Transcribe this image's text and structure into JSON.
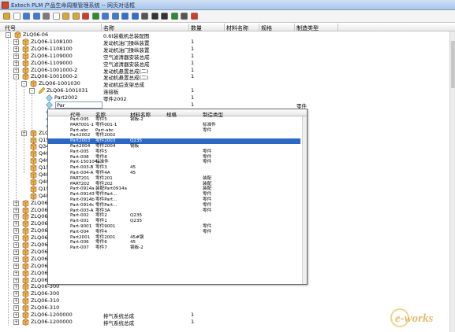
{
  "window": {
    "title": "Extech PLM 产品生命周期管理系统 -- 网页对话框"
  },
  "toolbar": {
    "icons": [
      "folder-icon",
      "new-icon",
      "move-icon",
      "add-icon",
      "cut-icon",
      "copy-icon",
      "paste-icon",
      "paste-special-icon",
      "delete-icon",
      "check-icon",
      "save-icon",
      "undo-icon",
      "up-icon",
      "down-icon",
      "tree-icon",
      "binoculars-icon",
      "sort-icon",
      "export-icon",
      "print-icon",
      "close-icon"
    ]
  },
  "columns": {
    "code": "代号",
    "name": "名称",
    "qty": "数量",
    "material": "材料名称",
    "spec": "规格",
    "mfg_type": "制造类型"
  },
  "rows": [
    {
      "code": "ZLQ06-06",
      "name": "0.6t装载机总装配图",
      "qty": "",
      "mfg": ""
    },
    {
      "code": "ZLQ06-1108100",
      "name": "发动机油门操纵装置",
      "qty": "1",
      "mfg": ""
    },
    {
      "code": "ZLQ06-1108100",
      "name": "发动机油门操纵装置",
      "qty": "1",
      "mfg": ""
    },
    {
      "code": "ZLQ06-1109000",
      "name": "空气滤清器安装总成",
      "qty": "1",
      "mfg": ""
    },
    {
      "code": "ZLQ06-1109000",
      "name": "空气滤清器安装总成",
      "qty": "1",
      "mfg": ""
    },
    {
      "code": "ZLQ06-1001000-2",
      "name": "发动机悬置总成(二)",
      "qty": "1",
      "mfg": ""
    },
    {
      "code": "ZLQ06-1001000-2",
      "name": "发动机悬置总成(二)",
      "qty": "1",
      "mfg": ""
    },
    {
      "code": "ZLQ06-1001030",
      "name": "发动机后支架总成",
      "qty": "",
      "mfg": ""
    },
    {
      "code": "ZLQ06-1001031",
      "name": "连接板",
      "qty": "1",
      "mfg": ""
    },
    {
      "code": "Part2002",
      "name": "零件2002",
      "qty": "1",
      "mfg": ""
    },
    {
      "code": "Par",
      "name": "",
      "qty": "1",
      "mfg": "零件"
    },
    {
      "code": "",
      "name": "",
      "qty": "",
      "mfg": ""
    },
    {
      "code": "ZLQ",
      "name": "",
      "qty": "",
      "mfg": ""
    },
    {
      "code": "ZLQ",
      "name": "",
      "qty": "",
      "mfg": ""
    },
    {
      "code": "ZLQ06-",
      "name": "",
      "qty": "",
      "mfg": ""
    },
    {
      "code": "Q1508",
      "name": "",
      "qty": "",
      "mfg": ""
    },
    {
      "code": "Q3408",
      "name": "",
      "qty": "",
      "mfg": ""
    },
    {
      "code": "Q40310",
      "name": "",
      "qty": "",
      "mfg": ""
    },
    {
      "code": "Q40110",
      "name": "",
      "qty": "",
      "mfg": ""
    },
    {
      "code": "Q1508",
      "name": "",
      "qty": "",
      "mfg": ""
    },
    {
      "code": "Q40220",
      "name": "",
      "qty": "",
      "mfg": ""
    },
    {
      "code": "Q40310",
      "name": "",
      "qty": "",
      "mfg": ""
    },
    {
      "code": "Q1508",
      "name": "",
      "qty": "",
      "mfg": ""
    },
    {
      "code": "Q40310",
      "name": "",
      "qty": "",
      "mfg": ""
    },
    {
      "code": "ZLQ06-860",
      "name": "",
      "qty": "",
      "mfg": ""
    },
    {
      "code": "ZLQ06-860",
      "name": "",
      "qty": "",
      "mfg": ""
    },
    {
      "code": "ZLQ06-860",
      "name": "",
      "qty": "",
      "mfg": ""
    },
    {
      "code": "ZLQ06-120",
      "name": "",
      "qty": "",
      "mfg": ""
    },
    {
      "code": "ZLQ06-120",
      "name": "",
      "qty": "",
      "mfg": ""
    },
    {
      "code": "ZLQ06-280",
      "name": "",
      "qty": "",
      "mfg": ""
    },
    {
      "code": "ZLQ06-280",
      "name": "",
      "qty": "",
      "mfg": ""
    },
    {
      "code": "ZLQ06-680",
      "name": "",
      "qty": "",
      "mfg": ""
    },
    {
      "code": "ZLQ06-680",
      "name": "",
      "qty": "",
      "mfg": ""
    },
    {
      "code": "ZLQ06-370",
      "name": "",
      "qty": "",
      "mfg": ""
    },
    {
      "code": "ZLQ06-820",
      "name": "",
      "qty": "",
      "mfg": ""
    },
    {
      "code": "ZLQ06-820",
      "name": "",
      "qty": "",
      "mfg": ""
    },
    {
      "code": "ZLQ06-300",
      "name": "",
      "qty": "",
      "mfg": ""
    },
    {
      "code": "ZLQ06-300",
      "name": "",
      "qty": "",
      "mfg": ""
    },
    {
      "code": "ZLQ06-310",
      "name": "",
      "qty": "",
      "mfg": ""
    },
    {
      "code": "ZLQ06-310",
      "name": "",
      "qty": "",
      "mfg": ""
    },
    {
      "code": "ZLQ06-1200000",
      "name": "排气系统总成",
      "qty": "1",
      "mfg": ""
    },
    {
      "code": "ZLQ06-1200000",
      "name": "排气系统总成",
      "qty": "1",
      "mfg": ""
    }
  ],
  "popup": {
    "columns": {
      "code": "代号",
      "name": "名称",
      "material": "材料名称",
      "spec": "规格",
      "mfg": "制造类型"
    },
    "rows": [
      {
        "code": "Part-005",
        "name": "零件5",
        "material": "钢板-2",
        "spec": "",
        "mfg": ""
      },
      {
        "code": "PART001-1",
        "name": "零件001-1",
        "material": "",
        "spec": "",
        "mfg": "标准件"
      },
      {
        "code": "Part-abc",
        "name": "Part-abc",
        "material": "",
        "spec": "",
        "mfg": "零件"
      },
      {
        "code": "Part2002",
        "name": "零件2002",
        "material": "",
        "spec": "",
        "mfg": ""
      },
      {
        "code": "Part2003",
        "name": "零件2003",
        "material": "Q235",
        "spec": "",
        "mfg": ""
      },
      {
        "code": "Part2004",
        "name": "零件2004",
        "material": "钢板",
        "spec": "",
        "mfg": ""
      },
      {
        "code": "Part-005",
        "name": "零件5",
        "material": "",
        "spec": "",
        "mfg": "零件"
      },
      {
        "code": "Part-008",
        "name": "零件8",
        "material": "",
        "spec": "",
        "mfg": "零件"
      },
      {
        "code": "Part-150104a",
        "name": "标准件",
        "material": "",
        "spec": "",
        "mfg": "零件"
      },
      {
        "code": "Part-003-B",
        "name": "零件3",
        "material": "45",
        "spec": "",
        "mfg": ""
      },
      {
        "code": "Part-004-A",
        "name": "零件4A",
        "material": "45",
        "spec": "",
        "mfg": ""
      },
      {
        "code": "PART201",
        "name": "零件201",
        "material": "",
        "spec": "",
        "mfg": "装配"
      },
      {
        "code": "PART202",
        "name": "零件202",
        "material": "",
        "spec": "",
        "mfg": "装配"
      },
      {
        "code": "Part-0914a",
        "name": "装配Part0914a",
        "material": "",
        "spec": "",
        "mfg": "装配"
      },
      {
        "code": "Part-09143",
        "name": "零件Part...",
        "material": "",
        "spec": "",
        "mfg": "零件"
      },
      {
        "code": "Part-0914b",
        "name": "零件Part...",
        "material": "",
        "spec": "",
        "mfg": "零件"
      },
      {
        "code": "Part-0914c",
        "name": "零件Part...",
        "material": "",
        "spec": "",
        "mfg": "零件"
      },
      {
        "code": "Part-003-A",
        "name": "零件3A",
        "material": "",
        "spec": "",
        "mfg": "零件"
      },
      {
        "code": "Part-002",
        "name": "零件2",
        "material": "Q235",
        "spec": "",
        "mfg": ""
      },
      {
        "code": "Part-001",
        "name": "零件1",
        "material": "Q235",
        "spec": "",
        "mfg": ""
      },
      {
        "code": "Part-9001",
        "name": "零件9001",
        "material": "",
        "spec": "",
        "mfg": "零件"
      },
      {
        "code": "Part-004",
        "name": "零件4",
        "material": "",
        "spec": "",
        "mfg": "零件"
      },
      {
        "code": "Part2001",
        "name": "零件2001",
        "material": "45#钢",
        "spec": "",
        "mfg": ""
      },
      {
        "code": "Part-006",
        "name": "零件6",
        "material": "45",
        "spec": "",
        "mfg": ""
      },
      {
        "code": "Part-007",
        "name": "零件7",
        "material": "钢板-2",
        "spec": "",
        "mfg": ""
      }
    ]
  },
  "watermark": {
    "text": "e-works"
  }
}
